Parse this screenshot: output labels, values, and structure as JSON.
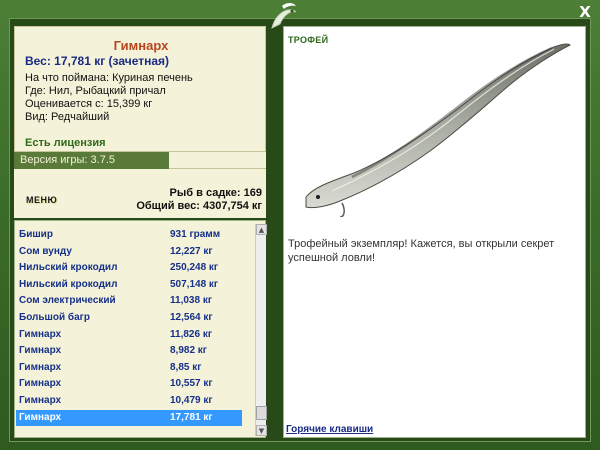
{
  "window": {
    "close_icon": "close-icon",
    "emblem_icon": "fish-emblem-icon",
    "close_symbol": "X"
  },
  "fish_info": {
    "title": "Гимнарх",
    "weight_line": "Вес: 17,781 кг (зачетная)",
    "bait_line": "На что поймана: Куриная печень",
    "place_line": "Где: Нил, Рыбацкий причал",
    "price_line": "Оценивается с: 15,399 кг",
    "kind_line": "Вид: Редчайший",
    "license": "Есть лицензия"
  },
  "version": "Версия игры: 3.7.5",
  "stats": {
    "menu_label": "МЕНЮ",
    "cage_count": "Рыб в садке: 169",
    "total_weight": "Общий вес: 4307,754 кг"
  },
  "catch_list": [
    {
      "name": "Бишир",
      "weight": "931 грамм"
    },
    {
      "name": "Сом вунду",
      "weight": "12,227 кг"
    },
    {
      "name": "Нильский крокодил",
      "weight": "250,248 кг"
    },
    {
      "name": "Нильский крокодил",
      "weight": "507,148 кг"
    },
    {
      "name": "Сом электрический",
      "weight": "11,038 кг"
    },
    {
      "name": "Большой багр",
      "weight": "12,564 кг"
    },
    {
      "name": "Гимнарх",
      "weight": "11,826 кг"
    },
    {
      "name": "Гимнарх",
      "weight": "8,982 кг"
    },
    {
      "name": "Гимнарх",
      "weight": "8,85 кг"
    },
    {
      "name": "Гимнарх",
      "weight": "10,557 кг"
    },
    {
      "name": "Гимнарх",
      "weight": "10,479 кг"
    },
    {
      "name": "Гимнарх",
      "weight": "17,781 кг",
      "selected": true
    }
  ],
  "list_scroll_position": 0.97,
  "trophy": {
    "tag": "ТРОФЕЙ",
    "message": "Трофейный экземпляр! Кажется, вы открыли секрет успешной ловли!",
    "hotkeys": "Горячие клавиши"
  },
  "colors": {
    "frame_green": "#3f6e2c",
    "panel_cream": "#f4f2d8",
    "title_orange": "#b8451e",
    "text_blue": "#1a2a86",
    "selection_blue": "#3399ff"
  }
}
